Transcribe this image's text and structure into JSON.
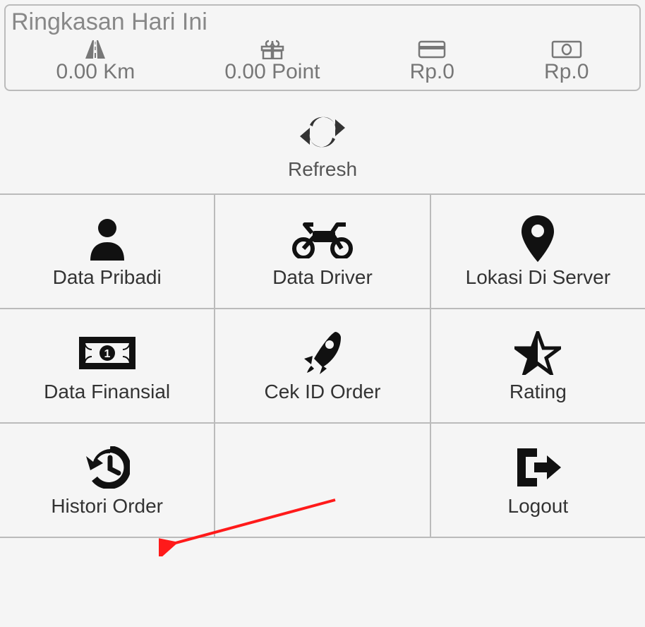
{
  "summary": {
    "title": "Ringkasan Hari Ini",
    "items": [
      {
        "icon": "road-icon",
        "value": "0.00 Km"
      },
      {
        "icon": "gift-icon",
        "value": "0.00 Point"
      },
      {
        "icon": "card-icon",
        "value": "Rp.0"
      },
      {
        "icon": "cash-icon",
        "value": "Rp.0"
      }
    ]
  },
  "refresh": {
    "label": "Refresh"
  },
  "menu": [
    {
      "icon": "user-icon",
      "label": "Data Pribadi"
    },
    {
      "icon": "motorcycle-icon",
      "label": "Data Driver"
    },
    {
      "icon": "map-pin-icon",
      "label": "Lokasi Di Server"
    },
    {
      "icon": "money-icon",
      "label": "Data Finansial"
    },
    {
      "icon": "rocket-icon",
      "label": "Cek ID Order"
    },
    {
      "icon": "star-icon",
      "label": "Rating"
    },
    {
      "icon": "history-icon",
      "label": "Histori Order"
    },
    {
      "icon": "",
      "label": ""
    },
    {
      "icon": "logout-icon",
      "label": "Logout"
    }
  ]
}
